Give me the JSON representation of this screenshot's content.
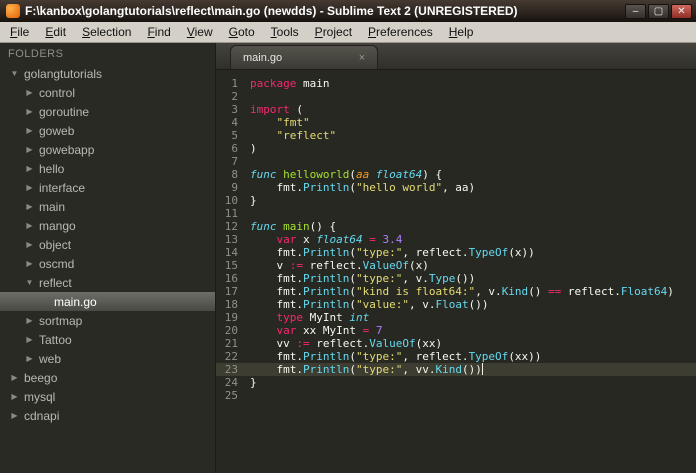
{
  "window": {
    "title": "F:\\kanbox\\golangtutorials\\reflect\\main.go (newdds) - Sublime Text 2 (UNREGISTERED)",
    "controls": {
      "minimize": "–",
      "maximize": "▢",
      "close": "✕"
    }
  },
  "menu": {
    "items": [
      "File",
      "Edit",
      "Selection",
      "Find",
      "View",
      "Goto",
      "Tools",
      "Project",
      "Preferences",
      "Help"
    ]
  },
  "icons": {
    "expanded": "▼",
    "collapsed": "▶",
    "none": "",
    "close": "×"
  },
  "sidebar": {
    "header": "FOLDERS",
    "items": [
      {
        "label": "golangtutorials",
        "depth": 0,
        "state": "expanded",
        "type": "folder"
      },
      {
        "label": "control",
        "depth": 1,
        "state": "collapsed",
        "type": "folder"
      },
      {
        "label": "goroutine",
        "depth": 1,
        "state": "collapsed",
        "type": "folder"
      },
      {
        "label": "goweb",
        "depth": 1,
        "state": "collapsed",
        "type": "folder"
      },
      {
        "label": "gowebapp",
        "depth": 1,
        "state": "collapsed",
        "type": "folder"
      },
      {
        "label": "hello",
        "depth": 1,
        "state": "collapsed",
        "type": "folder"
      },
      {
        "label": "interface",
        "depth": 1,
        "state": "collapsed",
        "type": "folder"
      },
      {
        "label": "main",
        "depth": 1,
        "state": "collapsed",
        "type": "folder"
      },
      {
        "label": "mango",
        "depth": 1,
        "state": "collapsed",
        "type": "folder"
      },
      {
        "label": "object",
        "depth": 1,
        "state": "collapsed",
        "type": "folder"
      },
      {
        "label": "oscmd",
        "depth": 1,
        "state": "collapsed",
        "type": "folder"
      },
      {
        "label": "reflect",
        "depth": 1,
        "state": "expanded",
        "type": "folder"
      },
      {
        "label": "main.go",
        "depth": 2,
        "state": "none",
        "type": "file",
        "selected": true
      },
      {
        "label": "sortmap",
        "depth": 1,
        "state": "collapsed",
        "type": "folder"
      },
      {
        "label": "Tattoo",
        "depth": 1,
        "state": "collapsed",
        "type": "folder"
      },
      {
        "label": "web",
        "depth": 1,
        "state": "collapsed",
        "type": "folder"
      },
      {
        "label": "beego",
        "depth": 0,
        "state": "collapsed",
        "type": "folder"
      },
      {
        "label": "mysql",
        "depth": 0,
        "state": "collapsed",
        "type": "folder"
      },
      {
        "label": "cdnapi",
        "depth": 0,
        "state": "collapsed",
        "type": "folder"
      }
    ]
  },
  "tabs": [
    {
      "label": "main.go",
      "active": true
    }
  ],
  "colors": {
    "editor_bg": "#272822",
    "keyword": "#f92672",
    "string": "#e6db74",
    "number": "#ae81ff",
    "type": "#66d9ef",
    "function": "#a6e22e",
    "foreground": "#f8f8f2",
    "selected_row": "#5a5a55",
    "current_line": "#3e3d32"
  },
  "editor": {
    "lines": [
      {
        "n": 1,
        "tokens": [
          [
            "kw",
            "package"
          ],
          [
            "fg",
            " main"
          ]
        ]
      },
      {
        "n": 2,
        "tokens": []
      },
      {
        "n": 3,
        "tokens": [
          [
            "kw",
            "import"
          ],
          [
            "fg",
            " ("
          ]
        ]
      },
      {
        "n": 4,
        "tokens": [
          [
            "fg",
            "    "
          ],
          [
            "str",
            "\"fmt\""
          ]
        ]
      },
      {
        "n": 5,
        "tokens": [
          [
            "fg",
            "    "
          ],
          [
            "str",
            "\"reflect\""
          ]
        ]
      },
      {
        "n": 6,
        "tokens": [
          [
            "fg",
            ")"
          ]
        ]
      },
      {
        "n": 7,
        "tokens": []
      },
      {
        "n": 8,
        "tokens": [
          [
            "st",
            "func"
          ],
          [
            "fg",
            " "
          ],
          [
            "fn",
            "helloworld"
          ],
          [
            "fg",
            "("
          ],
          [
            "par",
            "aa"
          ],
          [
            "fg",
            " "
          ],
          [
            "st",
            "float64"
          ],
          [
            "fg",
            ") {"
          ]
        ]
      },
      {
        "n": 9,
        "tokens": [
          [
            "fg",
            "    fmt."
          ],
          [
            "sup",
            "Println"
          ],
          [
            "fg",
            "("
          ],
          [
            "str",
            "\"hello world\""
          ],
          [
            "fg",
            ", aa)"
          ]
        ]
      },
      {
        "n": 10,
        "tokens": [
          [
            "fg",
            "}"
          ]
        ]
      },
      {
        "n": 11,
        "tokens": []
      },
      {
        "n": 12,
        "tokens": [
          [
            "st",
            "func"
          ],
          [
            "fg",
            " "
          ],
          [
            "fn",
            "main"
          ],
          [
            "fg",
            "() {"
          ]
        ]
      },
      {
        "n": 13,
        "tokens": [
          [
            "fg",
            "    "
          ],
          [
            "kw",
            "var"
          ],
          [
            "fg",
            " x "
          ],
          [
            "st",
            "float64"
          ],
          [
            "fg",
            " "
          ],
          [
            "kw",
            "="
          ],
          [
            "fg",
            " "
          ],
          [
            "num",
            "3.4"
          ]
        ]
      },
      {
        "n": 14,
        "tokens": [
          [
            "fg",
            "    fmt."
          ],
          [
            "sup",
            "Println"
          ],
          [
            "fg",
            "("
          ],
          [
            "str",
            "\"type:\""
          ],
          [
            "fg",
            ", reflect."
          ],
          [
            "sup",
            "TypeOf"
          ],
          [
            "fg",
            "(x))"
          ]
        ]
      },
      {
        "n": 15,
        "tokens": [
          [
            "fg",
            "    v "
          ],
          [
            "kw",
            ":="
          ],
          [
            "fg",
            " reflect."
          ],
          [
            "sup",
            "ValueOf"
          ],
          [
            "fg",
            "(x)"
          ]
        ]
      },
      {
        "n": 16,
        "tokens": [
          [
            "fg",
            "    fmt."
          ],
          [
            "sup",
            "Println"
          ],
          [
            "fg",
            "("
          ],
          [
            "str",
            "\"type:\""
          ],
          [
            "fg",
            ", v."
          ],
          [
            "sup",
            "Type"
          ],
          [
            "fg",
            "())"
          ]
        ]
      },
      {
        "n": 17,
        "tokens": [
          [
            "fg",
            "    fmt."
          ],
          [
            "sup",
            "Println"
          ],
          [
            "fg",
            "("
          ],
          [
            "str",
            "\"kind is float64:\""
          ],
          [
            "fg",
            ", v."
          ],
          [
            "sup",
            "Kind"
          ],
          [
            "fg",
            "() "
          ],
          [
            "kw",
            "=="
          ],
          [
            "fg",
            " reflect."
          ],
          [
            "sup",
            "Float64"
          ],
          [
            "fg",
            ")"
          ]
        ]
      },
      {
        "n": 18,
        "tokens": [
          [
            "fg",
            "    fmt."
          ],
          [
            "sup",
            "Println"
          ],
          [
            "fg",
            "("
          ],
          [
            "str",
            "\"value:\""
          ],
          [
            "fg",
            ", v."
          ],
          [
            "sup",
            "Float"
          ],
          [
            "fg",
            "())"
          ]
        ]
      },
      {
        "n": 19,
        "tokens": [
          [
            "fg",
            "    "
          ],
          [
            "kw",
            "type"
          ],
          [
            "fg",
            " MyInt "
          ],
          [
            "st",
            "int"
          ]
        ]
      },
      {
        "n": 20,
        "tokens": [
          [
            "fg",
            "    "
          ],
          [
            "kw",
            "var"
          ],
          [
            "fg",
            " xx MyInt "
          ],
          [
            "kw",
            "="
          ],
          [
            "fg",
            " "
          ],
          [
            "num",
            "7"
          ]
        ]
      },
      {
        "n": 21,
        "tokens": [
          [
            "fg",
            "    vv "
          ],
          [
            "kw",
            ":="
          ],
          [
            "fg",
            " reflect."
          ],
          [
            "sup",
            "ValueOf"
          ],
          [
            "fg",
            "(xx)"
          ]
        ]
      },
      {
        "n": 22,
        "tokens": [
          [
            "fg",
            "    fmt."
          ],
          [
            "sup",
            "Println"
          ],
          [
            "fg",
            "("
          ],
          [
            "str",
            "\"type:\""
          ],
          [
            "fg",
            ", reflect."
          ],
          [
            "sup",
            "TypeOf"
          ],
          [
            "fg",
            "(xx))"
          ]
        ]
      },
      {
        "n": 23,
        "tokens": [
          [
            "fg",
            "    fmt."
          ],
          [
            "sup",
            "Println"
          ],
          [
            "fg",
            "("
          ],
          [
            "str",
            "\"type:\""
          ],
          [
            "fg",
            ", vv."
          ],
          [
            "sup",
            "Kind"
          ],
          [
            "fg",
            "())"
          ]
        ],
        "current": true,
        "cursor": true
      },
      {
        "n": 24,
        "tokens": [
          [
            "fg",
            "}"
          ]
        ]
      },
      {
        "n": 25,
        "tokens": []
      }
    ]
  }
}
